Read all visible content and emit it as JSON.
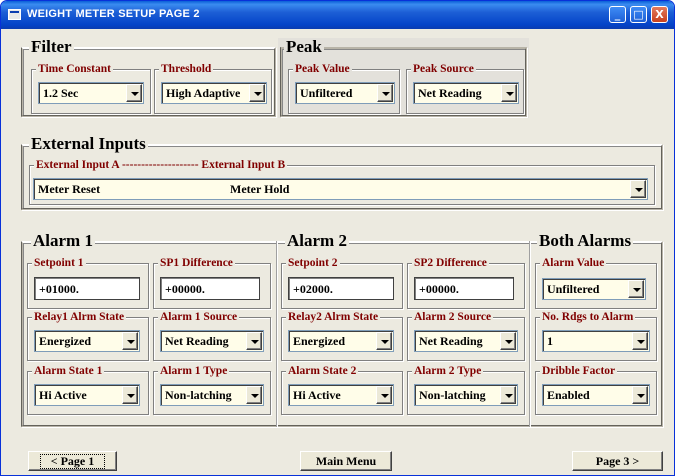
{
  "window": {
    "title": "WEIGHT METER SETUP  PAGE 2",
    "buttons": [
      "_",
      "□",
      "X"
    ]
  },
  "filter": {
    "title": "Filter",
    "time_constant": {
      "label": "Time Constant",
      "value": "1.2 Sec"
    },
    "threshold": {
      "label": "Threshold",
      "value": "High Adaptive"
    }
  },
  "peak": {
    "title": "Peak",
    "peak_value": {
      "label": "Peak Value",
      "value": "Unfiltered"
    },
    "peak_source": {
      "label": "Peak Source",
      "value": "Net Reading"
    }
  },
  "external_inputs": {
    "title": "External Inputs",
    "label_a": "External Input A",
    "separator": "--------------------",
    "label_b": "External Input B",
    "value_a": "Meter Reset",
    "value_b": "Meter Hold"
  },
  "alarm1": {
    "title": "Alarm 1",
    "setpoint": {
      "label": "Setpoint 1",
      "value": "+01000."
    },
    "difference": {
      "label": "SP1 Difference",
      "value": "+00000."
    },
    "relay_state": {
      "label": "Relay1 Alrm State",
      "value": "Energized"
    },
    "source": {
      "label": "Alarm 1 Source",
      "value": "Net Reading"
    },
    "alarm_state": {
      "label": "Alarm State 1",
      "value": "Hi Active"
    },
    "type": {
      "label": "Alarm 1 Type",
      "value": "Non-latching"
    }
  },
  "alarm2": {
    "title": "Alarm 2",
    "setpoint": {
      "label": "Setpoint 2",
      "value": "+02000."
    },
    "difference": {
      "label": "SP2 Difference",
      "value": "+00000."
    },
    "relay_state": {
      "label": "Relay2 Alrm State",
      "value": "Energized"
    },
    "source": {
      "label": "Alarm 2 Source",
      "value": "Net Reading"
    },
    "alarm_state": {
      "label": "Alarm State 2",
      "value": "Hi Active"
    },
    "type": {
      "label": "Alarm 2 Type",
      "value": "Non-latching"
    }
  },
  "both_alarms": {
    "title": "Both Alarms",
    "alarm_value": {
      "label": "Alarm Value",
      "value": "Unfiltered"
    },
    "rdgs_to_alarm": {
      "label": "No. Rdgs to Alarm",
      "value": "1"
    },
    "dribble_factor": {
      "label": "Dribble Factor",
      "value": "Enabled"
    }
  },
  "nav": {
    "prev": "<   Page 1",
    "main_menu": "Main Menu",
    "next": "Page 3   >"
  },
  "colors": {
    "title_bar": "#0443c8",
    "label_text": "#800000",
    "field_bg": "#fffde9",
    "window_bg": "#eceae0"
  }
}
